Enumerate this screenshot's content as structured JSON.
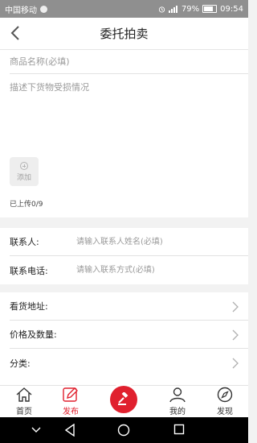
{
  "status_bar": {
    "carrier": "中国移动",
    "battery": "79%",
    "time": "09:54"
  },
  "header": {
    "title": "委托拍卖",
    "back_icon": "chevron-left-icon"
  },
  "form": {
    "product_name_placeholder": "商品名称(必填)",
    "description_placeholder": "描述下货物受损情况",
    "add_label": "添加",
    "upload_count": "已上传0/9"
  },
  "contact": {
    "name_label": "联系人:",
    "name_placeholder": "请输入联系人姓名(必填)",
    "phone_label": "联系电话:",
    "phone_placeholder": "请输入联系方式(必填)"
  },
  "options": [
    {
      "label": "看货地址:"
    },
    {
      "label": "价格及数量:"
    },
    {
      "label": "分类:"
    }
  ],
  "tabbar": {
    "tabs": [
      {
        "label": "首页",
        "icon": "home-icon"
      },
      {
        "label": "发布",
        "icon": "edit-icon",
        "active": true
      },
      {
        "label": "",
        "icon": "auction-hammer-icon"
      },
      {
        "label": "我的",
        "icon": "user-icon"
      },
      {
        "label": "发现",
        "icon": "compass-icon"
      }
    ]
  },
  "colors": {
    "accent": "#e0202e",
    "background": "#f2f2f2"
  }
}
